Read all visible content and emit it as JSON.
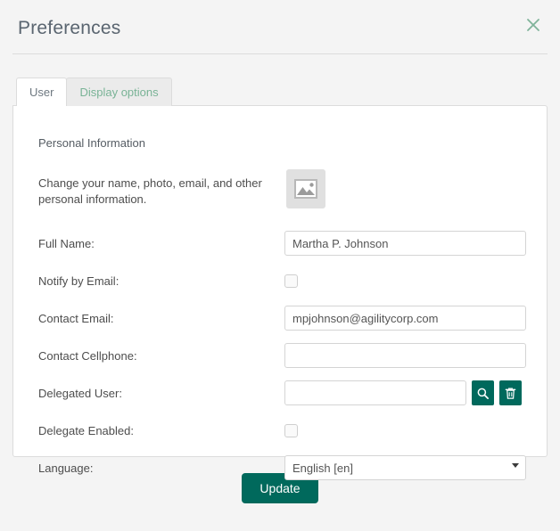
{
  "dialog": {
    "title": "Preferences",
    "close_icon": "close-icon"
  },
  "tabs": [
    {
      "label": "User",
      "active": true
    },
    {
      "label": "Display options",
      "active": false
    }
  ],
  "panel": {
    "section_title": "Personal Information",
    "intro_text": "Change your name, photo, email, and other personal information.",
    "photo_icon": "image-placeholder-icon"
  },
  "form": {
    "full_name": {
      "label": "Full Name:",
      "value": "Martha P. Johnson",
      "placeholder": ""
    },
    "notify_by_email": {
      "label": "Notify by Email:",
      "checked": false
    },
    "contact_email": {
      "label": "Contact Email:",
      "value": "mpjohnson@agilitycorp.com",
      "placeholder": ""
    },
    "contact_cellphone": {
      "label": "Contact Cellphone:",
      "value": "",
      "placeholder": ""
    },
    "delegated_user": {
      "label": "Delegated User:",
      "value": "",
      "placeholder": "",
      "search_icon": "search-icon",
      "clear_icon": "trash-icon"
    },
    "delegate_enabled": {
      "label": "Delegate Enabled:",
      "checked": false
    },
    "language": {
      "label": "Language:",
      "value": "English [en]"
    }
  },
  "footer": {
    "update_label": "Update"
  },
  "colors": {
    "accent": "#00695c",
    "tab_inactive_text": "#79b396",
    "close_icon": "#7fb39a",
    "page_background": "#f4f4f4",
    "panel_background": "#ffffff",
    "border": "#dcdcdc"
  }
}
